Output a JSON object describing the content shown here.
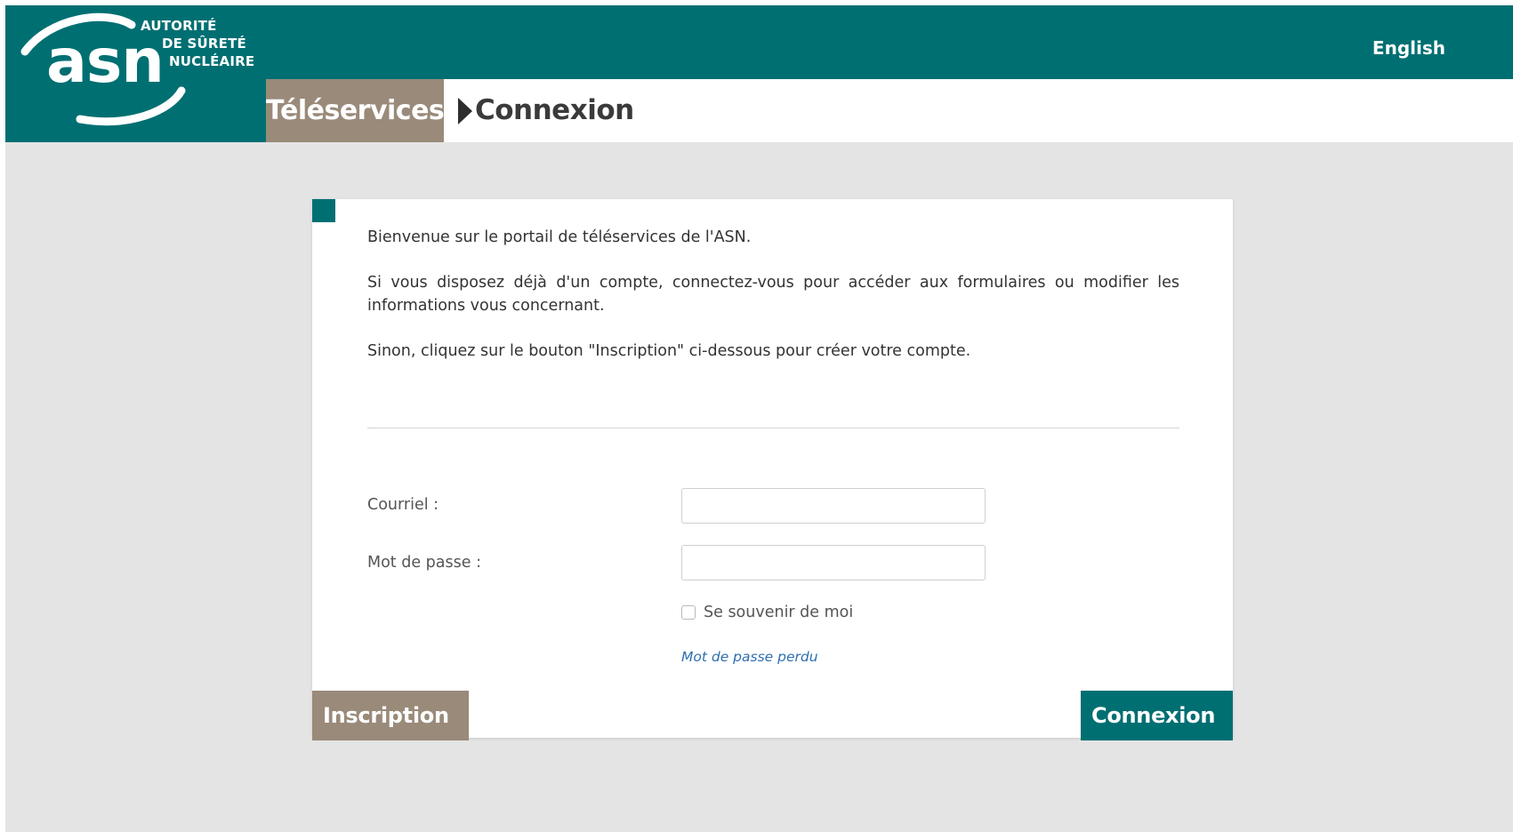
{
  "colors": {
    "brand_teal": "#006f72",
    "brand_taupe": "#9a8a7a",
    "page_bg": "#e4e4e4",
    "link_blue": "#2f6fb0"
  },
  "logo": {
    "mark": "asn",
    "line1": "AUTORITÉ",
    "line2": "DE SÛRETÉ",
    "line3": "NUCLÉAIRE"
  },
  "header": {
    "language_link": "English"
  },
  "breadcrumb": {
    "section": "Téléservices",
    "separator_icon": "triangle-right-icon",
    "current": "Connexion"
  },
  "intro": {
    "welcome": "Bienvenue sur le portail de téléservices de l'ASN.",
    "existing_account": "Si vous disposez déjà d'un compte, connectez-vous pour accéder aux formulaires ou modifier les informations vous concernant.",
    "no_account": "Sinon, cliquez sur le bouton \"Inscription\" ci-dessous pour créer votre compte."
  },
  "form": {
    "email_label": "Courriel :",
    "email_value": "",
    "email_placeholder": "",
    "password_label": "Mot de passe :",
    "password_value": "",
    "password_placeholder": "",
    "remember_label": "Se souvenir de moi",
    "remember_checked": false,
    "lost_password_link": "Mot de passe perdu"
  },
  "actions": {
    "register_label": "Inscription",
    "login_label": "Connexion"
  }
}
